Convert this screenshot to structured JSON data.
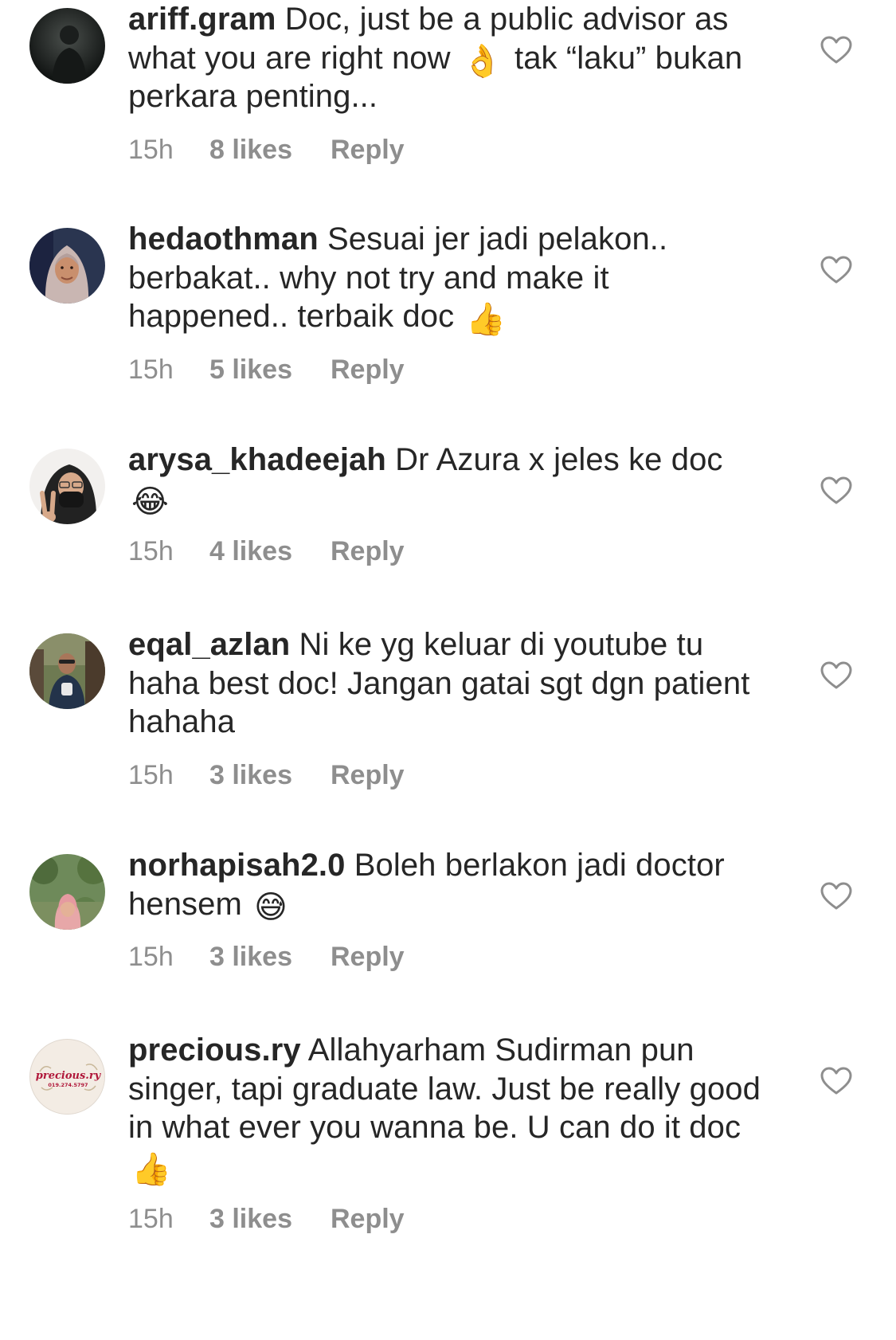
{
  "comments": [
    {
      "username": "ariff.gram",
      "segments": [
        {
          "type": "text",
          "value": " Doc, just be a public advisor as what you are right now "
        },
        {
          "type": "emoji",
          "value": "👌"
        },
        {
          "type": "text",
          "value": " tak “laku” bukan perkara penting..."
        }
      ],
      "time": "15h",
      "likes": "8 likes",
      "reply": "Reply",
      "avatar_icon": "dark-silhouette-avatar"
    },
    {
      "username": "hedaothman",
      "segments": [
        {
          "type": "text",
          "value": " Sesuai jer jadi pelakon.. berbakat.. why not try and make it happened.. terbaik doc "
        },
        {
          "type": "emoji",
          "value": "👍"
        }
      ],
      "time": "15h",
      "likes": "5 likes",
      "reply": "Reply",
      "avatar_icon": "hijab-portrait-avatar"
    },
    {
      "username": "arysa_khadeejah",
      "segments": [
        {
          "type": "text",
          "value": " Dr Azura x jeles ke doc "
        },
        {
          "type": "emoji",
          "value": "😂"
        }
      ],
      "time": "15h",
      "likes": "4 likes",
      "reply": "Reply",
      "avatar_icon": "masked-peace-sign-avatar"
    },
    {
      "username": "eqal_azlan",
      "segments": [
        {
          "type": "text",
          "value": " Ni ke yg keluar di youtube tu haha best doc! Jangan gatai sgt dgn patient hahaha"
        }
      ],
      "time": "15h",
      "likes": "3 likes",
      "reply": "Reply",
      "avatar_icon": "man-outdoor-avatar"
    },
    {
      "username": "norhapisah2.0",
      "segments": [
        {
          "type": "text",
          "value": " Boleh berlakon jadi doctor hensem "
        },
        {
          "type": "emoji",
          "value": "😅"
        }
      ],
      "time": "15h",
      "likes": "3 likes",
      "reply": "Reply",
      "avatar_icon": "woman-garden-avatar"
    },
    {
      "username": "precious.ry",
      "segments": [
        {
          "type": "text",
          "value": " Allahyarham Sudirman pun singer, tapi graduate law. Just be really good in what ever you wanna be. U can do it doc"
        },
        {
          "type": "emoji",
          "value": "👍"
        }
      ],
      "time": "15h",
      "likes": "3 likes",
      "reply": "Reply",
      "avatar_icon": "brand-logo-avatar",
      "logo_text": "precious.ry",
      "logo_phone": "019.274.5797"
    }
  ],
  "colors": {
    "text": "#262626",
    "meta": "#8e8e8e",
    "heart_stroke": "#8e8e8e",
    "logo": "#b0173a"
  }
}
